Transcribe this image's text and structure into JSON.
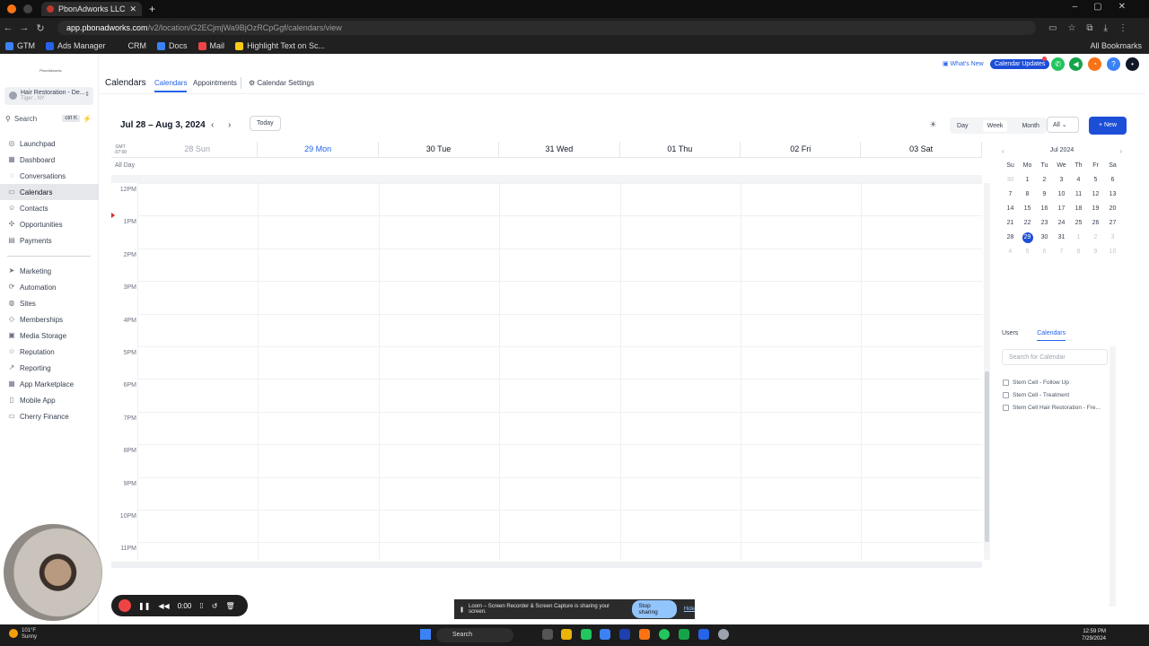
{
  "browser": {
    "tab_title": "PbonAdworks LLC",
    "url_host": "app.pbonadworks.com",
    "url_path": "/v2/location/G2ECjmjWa9BjOzRCpGgf/calendars/view",
    "bookmarks": [
      "GTM",
      "Ads Manager",
      "CRM",
      "Docs",
      "Mail",
      "Highlight Text on Sc..."
    ],
    "bookmarks_right": "All Bookmarks"
  },
  "sidebar": {
    "logo_text": "PbonAdworks",
    "account_name": "Hair Restoration - De...",
    "account_location": "Tiger , NY",
    "search_label": "Search",
    "search_kbd": "ctrl K",
    "group1": [
      {
        "label": "Launchpad",
        "icon": "launchpad-icon",
        "glyph": "◎"
      },
      {
        "label": "Dashboard",
        "icon": "dashboard-icon",
        "glyph": "▦"
      },
      {
        "label": "Conversations",
        "icon": "chat-icon",
        "glyph": "◌"
      },
      {
        "label": "Calendars",
        "icon": "calendar-icon",
        "glyph": "▭"
      },
      {
        "label": "Contacts",
        "icon": "contacts-icon",
        "glyph": "☺"
      },
      {
        "label": "Opportunities",
        "icon": "opportunities-icon",
        "glyph": "✣"
      },
      {
        "label": "Payments",
        "icon": "payments-icon",
        "glyph": "▤"
      }
    ],
    "group2": [
      {
        "label": "Marketing",
        "icon": "marketing-icon",
        "glyph": "➤"
      },
      {
        "label": "Automation",
        "icon": "automation-icon",
        "glyph": "⟳"
      },
      {
        "label": "Sites",
        "icon": "sites-icon",
        "glyph": "◍"
      },
      {
        "label": "Memberships",
        "icon": "memberships-icon",
        "glyph": "◇"
      },
      {
        "label": "Media Storage",
        "icon": "media-icon",
        "glyph": "▣"
      },
      {
        "label": "Reputation",
        "icon": "star-icon",
        "glyph": "☆"
      },
      {
        "label": "Reporting",
        "icon": "reporting-icon",
        "glyph": "↗"
      },
      {
        "label": "App Marketplace",
        "icon": "marketplace-icon",
        "glyph": "▦"
      },
      {
        "label": "Mobile App",
        "icon": "mobile-icon",
        "glyph": "▯"
      },
      {
        "label": "Cherry Finance",
        "icon": "finance-icon",
        "glyph": "▭"
      }
    ]
  },
  "topbar": {
    "title": "Calendars",
    "tabs": [
      "Calendars",
      "Appointments",
      "Calendar Settings"
    ],
    "whats_new": "What's New",
    "updates": "Calendar Updates",
    "colors": {
      "phone": "#22c55e",
      "megaphone": "#16a34a",
      "bell": "#f97316",
      "help": "#3b82f6",
      "avatar": "#111827"
    }
  },
  "calendar": {
    "range": "Jul 28 – Aug 3, 2024",
    "today_label": "Today",
    "views": [
      "Day",
      "Week",
      "Month"
    ],
    "filter": "All",
    "new_label": "+ New",
    "gmt": "GMT\n-07:00",
    "all_day": "All Day",
    "days": [
      "28 Sun",
      "29 Mon",
      "30 Tue",
      "31 Wed",
      "01 Thu",
      "02 Fri",
      "03 Sat"
    ],
    "hours": [
      "12PM",
      "1PM",
      "2PM",
      "3PM",
      "4PM",
      "5PM",
      "6PM",
      "7PM",
      "8PM",
      "9PM",
      "10PM",
      "11PM"
    ]
  },
  "mini_calendar": {
    "month": "Jul 2024",
    "weekdays": [
      "Su",
      "Mo",
      "Tu",
      "We",
      "Th",
      "Fr",
      "Sa"
    ],
    "weeks": [
      [
        "30",
        "1",
        "2",
        "3",
        "4",
        "5",
        "6"
      ],
      [
        "7",
        "8",
        "9",
        "10",
        "11",
        "12",
        "13"
      ],
      [
        "14",
        "15",
        "16",
        "17",
        "18",
        "19",
        "20"
      ],
      [
        "21",
        "22",
        "23",
        "24",
        "25",
        "26",
        "27"
      ],
      [
        "28",
        "29",
        "30",
        "31",
        "1",
        "2",
        "3"
      ],
      [
        "4",
        "5",
        "6",
        "7",
        "8",
        "9",
        "10"
      ]
    ],
    "selected": "29"
  },
  "right_panel": {
    "tabs": [
      "Users",
      "Calendars"
    ],
    "search_placeholder": "Search for Calendar",
    "calendars": [
      "Stem Cell - Follow Up",
      "Stem Cell - Treatment",
      "Stem Cell Hair Restoration - Fre..."
    ]
  },
  "loom": {
    "timer": "0:00",
    "banner_text": "Loom – Screen Recorder & Screen Capture is sharing your screen.",
    "stop_label": "Stop sharing",
    "hide_label": "Hide"
  },
  "taskbar": {
    "temp": "101°F",
    "weather": "Sunny",
    "search": "Search",
    "time": "12:59 PM",
    "date": "7/29/2024"
  }
}
